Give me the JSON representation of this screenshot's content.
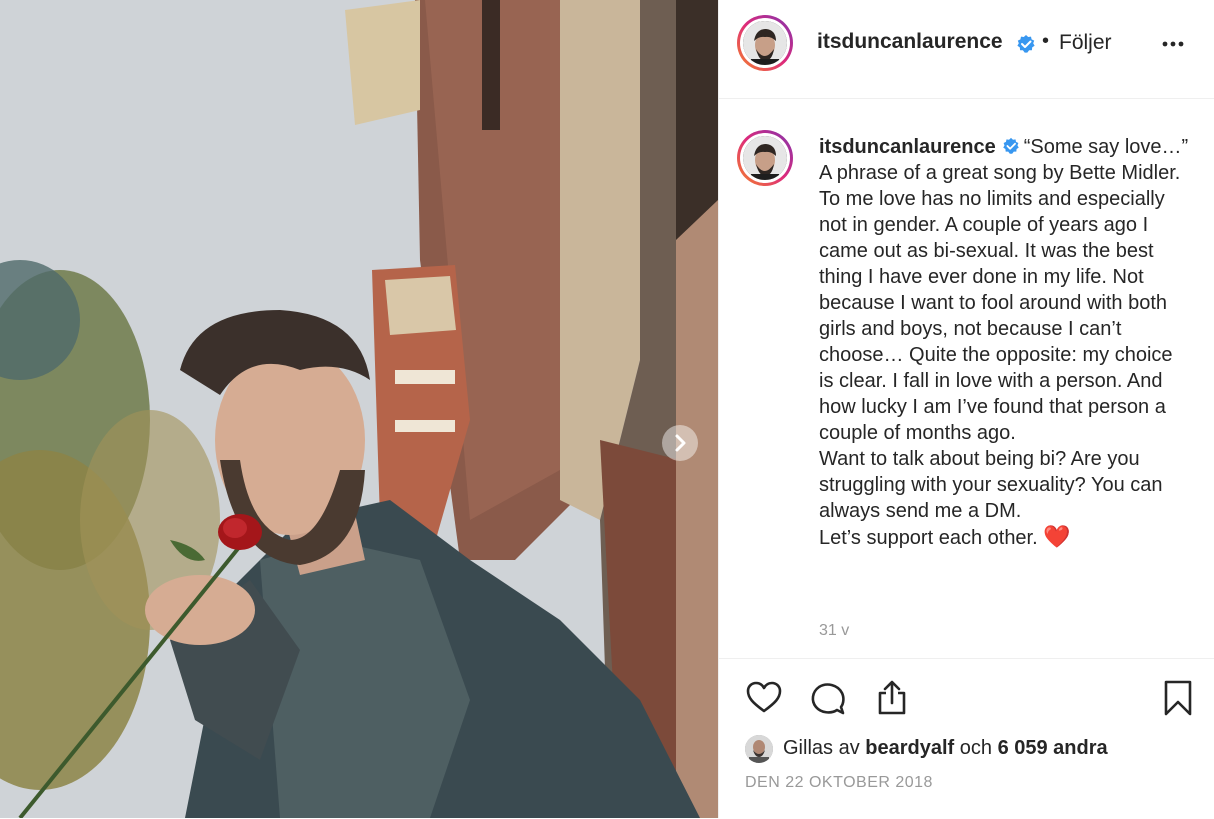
{
  "header": {
    "username": "itsduncanlaurence",
    "separator": "•",
    "follow_label": "Följer",
    "more_icon": "more-horizontal-icon",
    "verified_icon": "verified-badge-icon"
  },
  "caption": {
    "username": "itsduncanlaurence",
    "text": "“Some say love…” A phrase of a great song by Bette Midler. To me love has no limits and especially not in gender. A couple of years ago I came out as bi-sexual. It was the best thing I have ever done in my life. Not because I want to fool around with both girls and boys, not because I can’t choose… Quite the opposite: my choice is clear. I fall in love with a person. And how lucky I am I’ve found that person a couple of months ago.\nWant to talk about being bi? Are you struggling with your sexuality? You can always send me a DM.\nLet’s support each other. ",
    "emoji": "❤️",
    "time_ago": "31 v"
  },
  "actions": {
    "like_icon": "heart-icon",
    "comment_icon": "comment-icon",
    "share_icon": "share-icon",
    "save_icon": "bookmark-icon"
  },
  "likes": {
    "prefix": "Gillas av",
    "liker": "beardyalf",
    "conjunction": "och",
    "others": "6 059 andra"
  },
  "post_date": "DEN 22 OKTOBER 2018",
  "colors": {
    "verified": "#3897f0",
    "text": "#262626",
    "muted": "#999999",
    "heart": "#e0245e"
  }
}
